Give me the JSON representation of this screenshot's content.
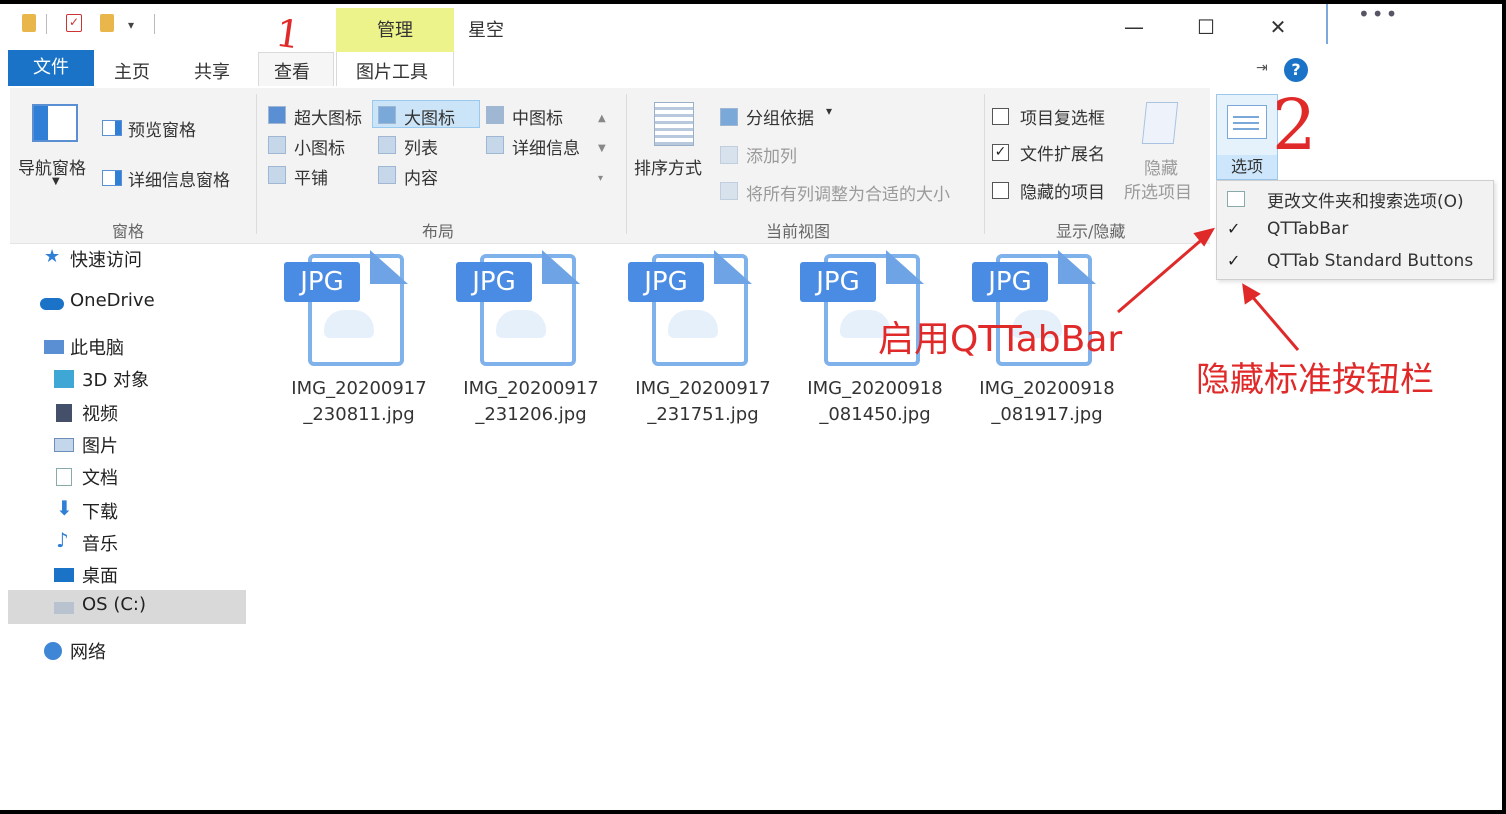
{
  "window": {
    "title": "星空",
    "contextual_tab_group": "管理",
    "minimize_symbol": "—",
    "maximize_symbol": "☐",
    "close_symbol": "✕",
    "more_symbol": "•••"
  },
  "tabs": {
    "file": "文件",
    "home": "主页",
    "share": "共享",
    "view": "查看",
    "picture_tools": "图片工具"
  },
  "ribbon": {
    "panes": {
      "label": "窗格",
      "navigation_pane": "导航窗格",
      "preview_pane": "预览窗格",
      "details_pane": "详细信息窗格"
    },
    "layout": {
      "label": "布局",
      "extra_large_icons": "超大图标",
      "large_icons": "大图标",
      "medium_icons": "中图标",
      "small_icons": "小图标",
      "list": "列表",
      "details": "详细信息",
      "tiles": "平铺",
      "content": "内容"
    },
    "current_view": {
      "label": "当前视图",
      "sort_by": "排序方式",
      "group_by": "分组依据",
      "add_columns": "添加列",
      "size_all_columns": "将所有列调整为合适的大小"
    },
    "show_hide": {
      "label": "显示/隐藏",
      "item_check_boxes": "项目复选框",
      "item_check_boxes_checked": false,
      "file_name_extensions": "文件扩展名",
      "file_name_extensions_checked": true,
      "hidden_items": "隐藏的项目",
      "hidden_items_checked": false,
      "hide_selected_line1": "隐藏",
      "hide_selected_line2": "所选项目"
    },
    "options": {
      "label": "选项",
      "menu": [
        {
          "label": "更改文件夹和搜索选项(O)",
          "checked": false
        },
        {
          "label": "QTTabBar",
          "checked": true
        },
        {
          "label": "QTTab Standard Buttons",
          "checked": true
        }
      ]
    }
  },
  "nav": {
    "quick_access": "快速访问",
    "onedrive": "OneDrive",
    "this_pc": "此电脑",
    "objects_3d": "3D 对象",
    "videos": "视频",
    "pictures": "图片",
    "documents": "文档",
    "downloads": "下载",
    "music": "音乐",
    "desktop": "桌面",
    "os_c": "OS (C:)",
    "network": "网络",
    "selected": "OS (C:)"
  },
  "files": [
    {
      "badge": "JPG",
      "line1": "IMG_20200917",
      "line2": "_230811.jpg"
    },
    {
      "badge": "JPG",
      "line1": "IMG_20200917",
      "line2": "_231206.jpg"
    },
    {
      "badge": "JPG",
      "line1": "IMG_20200917",
      "line2": "_231751.jpg"
    },
    {
      "badge": "JPG",
      "line1": "IMG_20200918",
      "line2": "_081450.jpg"
    },
    {
      "badge": "JPG",
      "line1": "IMG_20200918",
      "line2": "_081917.jpg"
    }
  ],
  "annotations": {
    "step1": "1",
    "step2": "2",
    "enable_qttabbar": "启用QTTabBar",
    "hide_standard_buttons": "隐藏标准按钮栏",
    "color": "#e02a2a"
  },
  "colors": {
    "accent": "#1a73c6",
    "contextual_tab": "#edf38b",
    "selection": "#cce4f7"
  }
}
